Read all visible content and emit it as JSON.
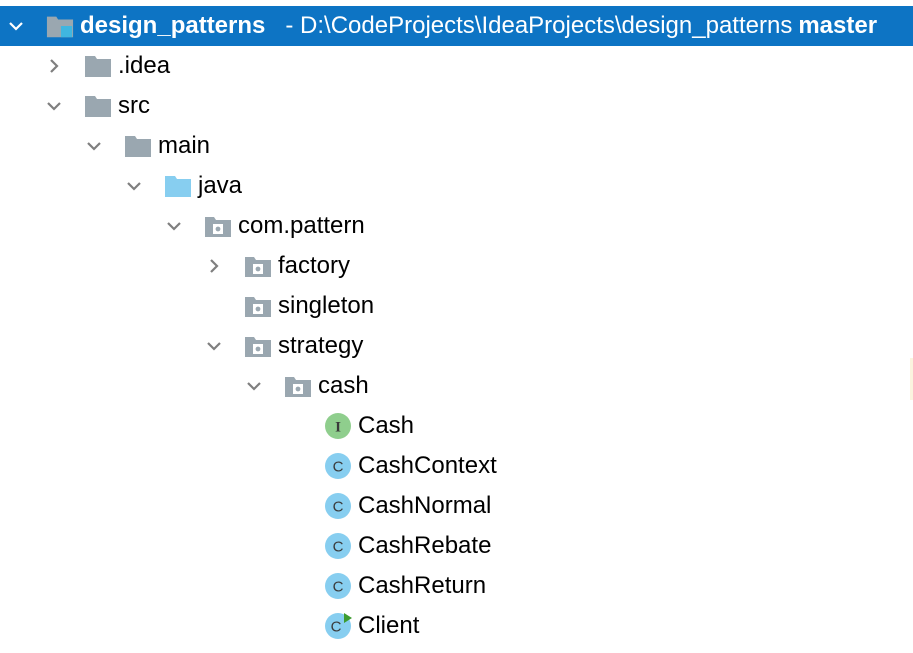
{
  "project_tree": {
    "root": {
      "name": "design_patterns",
      "path": "- D:\\CodeProjects\\IdeaProjects\\design_patterns",
      "branch": "master",
      "icon": "module-folder-icon",
      "expanded": true
    },
    "nodes": [
      {
        "label": ".idea",
        "icon": "folder-icon",
        "arrow": "collapsed"
      },
      {
        "label": "src",
        "icon": "folder-icon",
        "arrow": "expanded"
      },
      {
        "label": "main",
        "icon": "folder-icon",
        "arrow": "expanded"
      },
      {
        "label": "java",
        "icon": "source-root-folder-icon",
        "arrow": "expanded"
      },
      {
        "label": "com.pattern",
        "icon": "package-icon",
        "arrow": "expanded"
      },
      {
        "label": "factory",
        "icon": "package-icon",
        "arrow": "collapsed"
      },
      {
        "label": "singleton",
        "icon": "package-icon",
        "arrow": "none"
      },
      {
        "label": "strategy",
        "icon": "package-icon",
        "arrow": "expanded"
      },
      {
        "label": "cash",
        "icon": "package-icon",
        "arrow": "expanded"
      },
      {
        "label": "Cash",
        "icon": "interface-icon",
        "icon_letter": "I",
        "arrow": "none"
      },
      {
        "label": "CashContext",
        "icon": "class-icon",
        "icon_letter": "C",
        "arrow": "none"
      },
      {
        "label": "CashNormal",
        "icon": "class-icon",
        "icon_letter": "C",
        "arrow": "none"
      },
      {
        "label": "CashRebate",
        "icon": "class-icon",
        "icon_letter": "C",
        "arrow": "none"
      },
      {
        "label": "CashReturn",
        "icon": "class-icon",
        "icon_letter": "C",
        "arrow": "none"
      },
      {
        "label": "Client",
        "icon": "runnable-class-icon",
        "icon_letter": "C",
        "arrow": "none"
      }
    ]
  },
  "colors": {
    "selection": "#0d74c4",
    "folder": "#9aa7b0",
    "source_root_folder": "#87cef0",
    "class_circle": "#87cef0",
    "interface_circle": "#8fce8d",
    "run_marker": "#3d9b2f",
    "arrow": "#7f7f7f"
  }
}
